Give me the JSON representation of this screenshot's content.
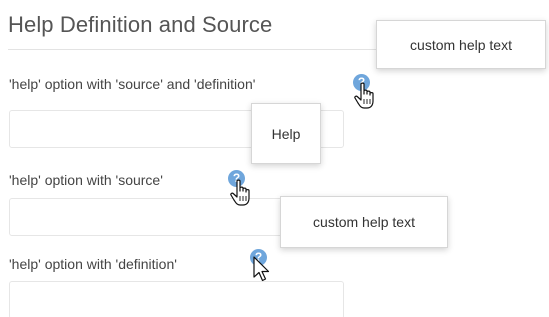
{
  "section": {
    "title": "Help Definition and Source"
  },
  "fields": [
    {
      "label": "'help' option with 'source' and 'definition'",
      "value": "",
      "help_icon": "question-mark",
      "tooltip": "custom help text"
    },
    {
      "label": "'help' option with 'source'",
      "value": "",
      "help_icon": "question-mark",
      "tooltip": "Help"
    },
    {
      "label": "'help' option with 'definition'",
      "value": "",
      "help_icon": "question-mark",
      "tooltip": "custom help text"
    }
  ],
  "help_glyph": "?",
  "colors": {
    "help_icon": "#6fa6dc",
    "title": "#555555",
    "label": "#444444"
  }
}
